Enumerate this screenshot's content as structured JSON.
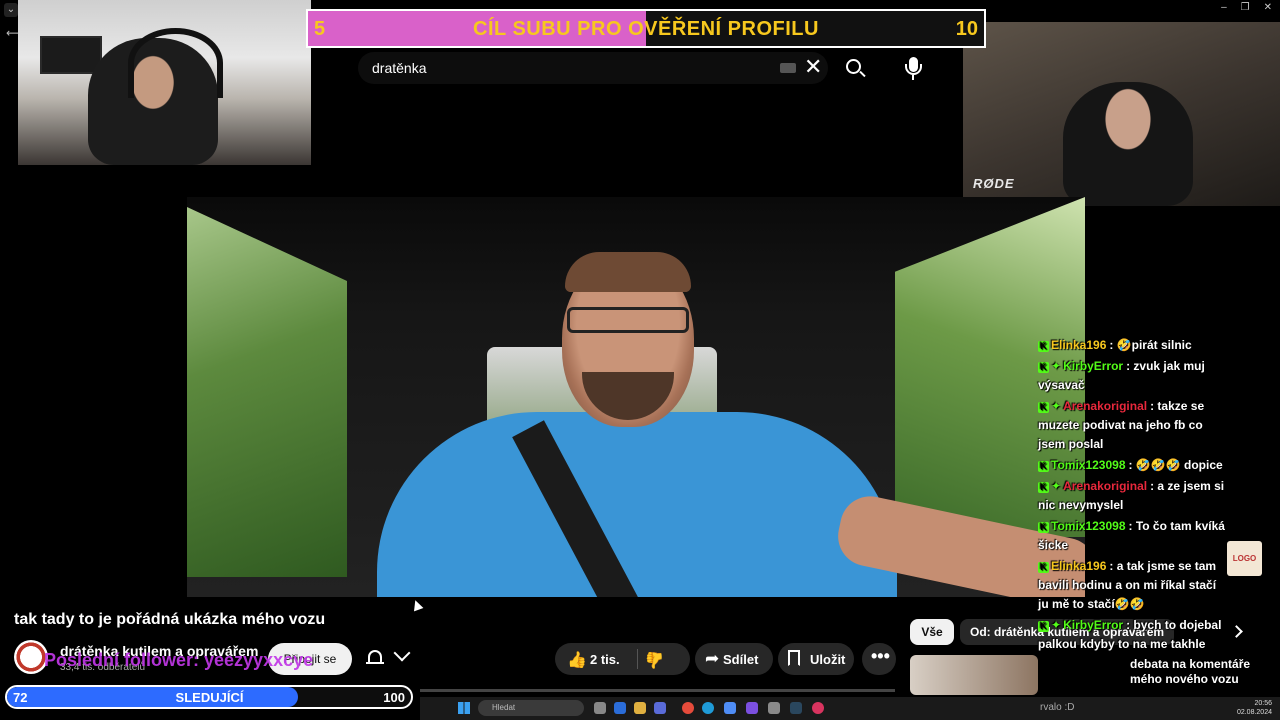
{
  "goal": {
    "start": "5",
    "title": "CÍL SUBU PRO OVĚŘENÍ PROFILU",
    "end": "10",
    "progress_fraction": 0.5,
    "fill_color": "#d961c9",
    "text_color": "#f7c81e"
  },
  "search": {
    "query": "dratěnka"
  },
  "video": {
    "title": "tak tady to je pořádná ukázka mého vozu"
  },
  "channel": {
    "name": "drátěnka kutilem a opravářem",
    "subscribers": "33,4 tis. odběratelů",
    "join_label": "Připojit se"
  },
  "overlay": {
    "last_follower": "Poslední follower: yeezyyxxcye",
    "last_follower_color": "#c238e8"
  },
  "actions": {
    "likes": "2 tis.",
    "share": "Sdílet",
    "save": "Uložit",
    "more": "•••"
  },
  "chips": {
    "all": "Vše",
    "from": "Od: drátěnka kutilem a opravářem"
  },
  "recommended": {
    "title": "debata na komentáře mého nového vozu"
  },
  "chat": {
    "messages": [
      {
        "user": "Elinka196",
        "user_color": "#f7c81e",
        "sparkle": false,
        "text": ": 🤣pirát silnic"
      },
      {
        "user": "KirbyError",
        "user_color": "#53fc18",
        "sparkle": true,
        "text": ": zvuk jak muj výsavač"
      },
      {
        "user": "Arenakoriginal",
        "user_color": "#e8283c",
        "sparkle": true,
        "text": ": takze se muzete podivat na jeho fb co jsem poslal"
      },
      {
        "user": "Tomix123098",
        "user_color": "#53fc18",
        "sparkle": false,
        "text": ": 🤣🤣🤣 dopice"
      },
      {
        "user": "Arenakoriginal",
        "user_color": "#e8283c",
        "sparkle": true,
        "text": ": a ze jsem si nic nevymyslel"
      },
      {
        "user": "Tomix123098",
        "user_color": "#53fc18",
        "sparkle": false,
        "text": ": To čo tam kvíká šicke"
      },
      {
        "user": "Elinka196",
        "user_color": "#f7c81e",
        "sparkle": false,
        "text": ": a tak jsme se tam bavili hodinu a on mi říkal stačí ju mě to stačí🤣🤣"
      },
      {
        "user": "KirbyError",
        "user_color": "#53fc18",
        "sparkle": true,
        "text": ": bych to dojebal palkou kdyby to na me takhle"
      }
    ]
  },
  "subbar": {
    "start": "72",
    "label": "SLEDUJÍCÍ",
    "end": "100",
    "progress_fraction": 0.72,
    "fill_color": "#2d6bff"
  },
  "taskbar": {
    "search_placeholder": "Hledat",
    "user": "rvalo :D",
    "time": "20:56",
    "date": "02.08.2024"
  },
  "cam_right": {
    "brand": "RØDE"
  }
}
